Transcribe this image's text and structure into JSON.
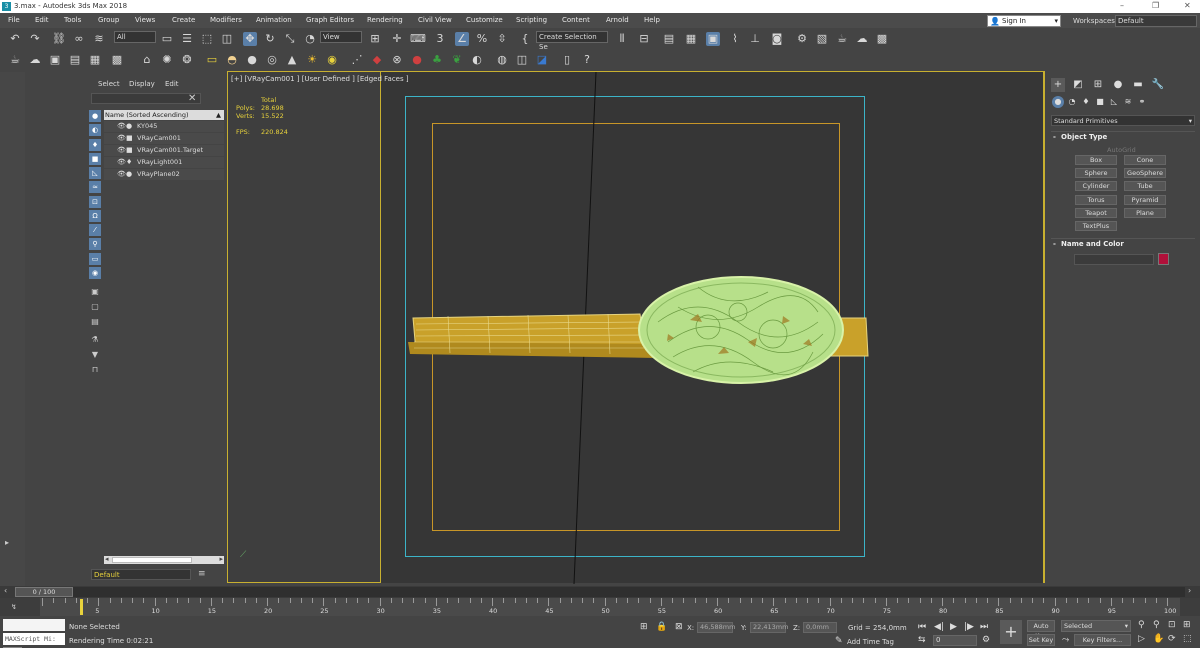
{
  "titlebar": {
    "app_icon": "3ds-max-icon",
    "title": "3.max - Autodesk 3ds Max 2018"
  },
  "menu": [
    "File",
    "Edit",
    "Tools",
    "Group",
    "Views",
    "Create",
    "Modifiers",
    "Animation",
    "Graph Editors",
    "Rendering",
    "Civil View",
    "Customize",
    "Scripting",
    "Content",
    "Arnold",
    "Help"
  ],
  "signin": {
    "label": "Sign In"
  },
  "workspaces": {
    "label": "Workspaces:",
    "value": "Default"
  },
  "toolbar": {
    "filter": "All",
    "view": "View",
    "selection_set": "Create Selection Se"
  },
  "scene_explorer": {
    "menu": [
      "Select",
      "Display",
      "Edit"
    ],
    "header": "Name (Sorted Ascending)",
    "rows": [
      {
        "name": "KY045",
        "icon": "sphere-icon"
      },
      {
        "name": "VRayCam001",
        "icon": "camera-icon"
      },
      {
        "name": "VRayCam001.Target",
        "icon": "target-icon"
      },
      {
        "name": "VRayLight001",
        "icon": "light-icon"
      },
      {
        "name": "VRayPlane02",
        "icon": "sphere-icon"
      }
    ],
    "layer": "Default"
  },
  "viewport": {
    "label": "[+] [VRayCam001 ] [User Defined ] [Edged Faces ]",
    "stats": {
      "total_label": "Total",
      "polys_label": "Polys:",
      "polys": "28.698",
      "verts_label": "Verts:",
      "verts": "15.522",
      "fps_label": "FPS:",
      "fps": "220.824"
    }
  },
  "command_panel": {
    "category": "Standard Primitives",
    "object_type_title": "Object Type",
    "autogrid": "AutoGrid",
    "buttons": [
      "Box",
      "Cone",
      "Sphere",
      "GeoSphere",
      "Cylinder",
      "Tube",
      "Torus",
      "Pyramid",
      "Teapot",
      "Plane",
      "TextPlus"
    ],
    "name_color_title": "Name and Color",
    "object_color": "#b0103a"
  },
  "timeline": {
    "frame_label": "0 / 100",
    "ticks": [
      "0",
      "5",
      "10",
      "15",
      "20",
      "25",
      "30",
      "35",
      "40",
      "45",
      "50",
      "55",
      "60",
      "65",
      "70",
      "75",
      "80",
      "85",
      "90",
      "95",
      "100"
    ]
  },
  "status": {
    "maxscript": "MAXScript Mi:",
    "selection": "None Selected",
    "render_time": "Rendering Time  0:02:21",
    "x_label": "X:",
    "x": "46,588mm",
    "y_label": "Y:",
    "y": "22,413mm",
    "z_label": "Z:",
    "z": "0,0mm",
    "grid": "Grid = 254,0mm",
    "add_time_tag": "Add Time Tag",
    "current_frame": "0",
    "auto_key": "Auto Key",
    "set_key": "Set Key",
    "selected": "Selected",
    "key_filters": "Key Filters..."
  }
}
